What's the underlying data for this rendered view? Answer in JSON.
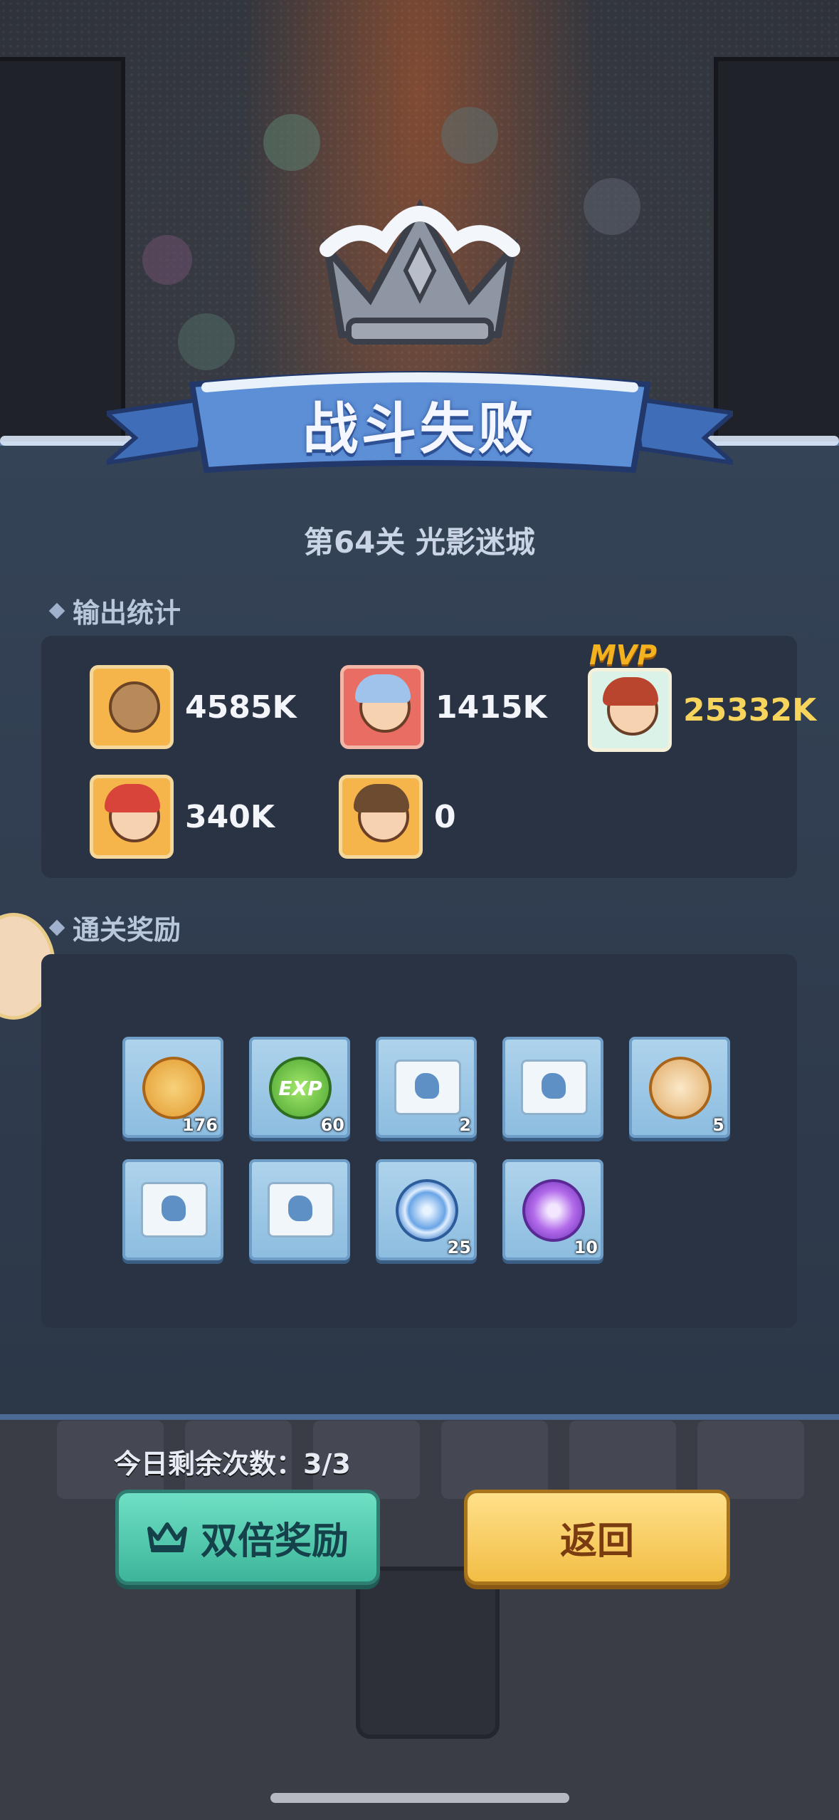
{
  "header": {
    "title": "战斗失败",
    "stage": "第64关 光影迷城"
  },
  "output_stats": {
    "label": "输出统计",
    "heroes": [
      {
        "value": "4585K",
        "frame": "orange",
        "icon": "bear-hero-portrait"
      },
      {
        "value": "1415K",
        "frame": "red",
        "icon": "blue-hair-hero-portrait"
      },
      {
        "value": "25332K",
        "frame": "teal",
        "icon": "crowned-warrior-portrait",
        "badge": "MVP"
      },
      {
        "value": "340K",
        "frame": "orange",
        "icon": "mermaid-hero-portrait"
      },
      {
        "value": "0",
        "frame": "orange",
        "icon": "brown-hair-hero-portrait"
      }
    ]
  },
  "rewards": {
    "label": "通关奖励",
    "items": [
      {
        "name": "gold-coin-icon",
        "count": "176"
      },
      {
        "name": "exp-orb-icon",
        "label": "EXP",
        "count": "60"
      },
      {
        "name": "scroll-armor-icon",
        "count": "2"
      },
      {
        "name": "scroll-boot-icon",
        "count": ""
      },
      {
        "name": "wing-medal-icon",
        "count": "5"
      },
      {
        "name": "scroll-wing-icon",
        "count": ""
      },
      {
        "name": "scroll-crown-icon",
        "count": ""
      },
      {
        "name": "swirl-orb-icon",
        "count": "25"
      },
      {
        "name": "purple-emblem-icon",
        "count": "10"
      }
    ]
  },
  "footer": {
    "remaining_label": "今日剩余次数：3/3",
    "double_button": "双倍奖励",
    "back_button": "返回"
  },
  "colors": {
    "panel": "#354357",
    "mvp_value": "#f7d45c",
    "double": "#4ec9aa",
    "back": "#f6c954"
  }
}
